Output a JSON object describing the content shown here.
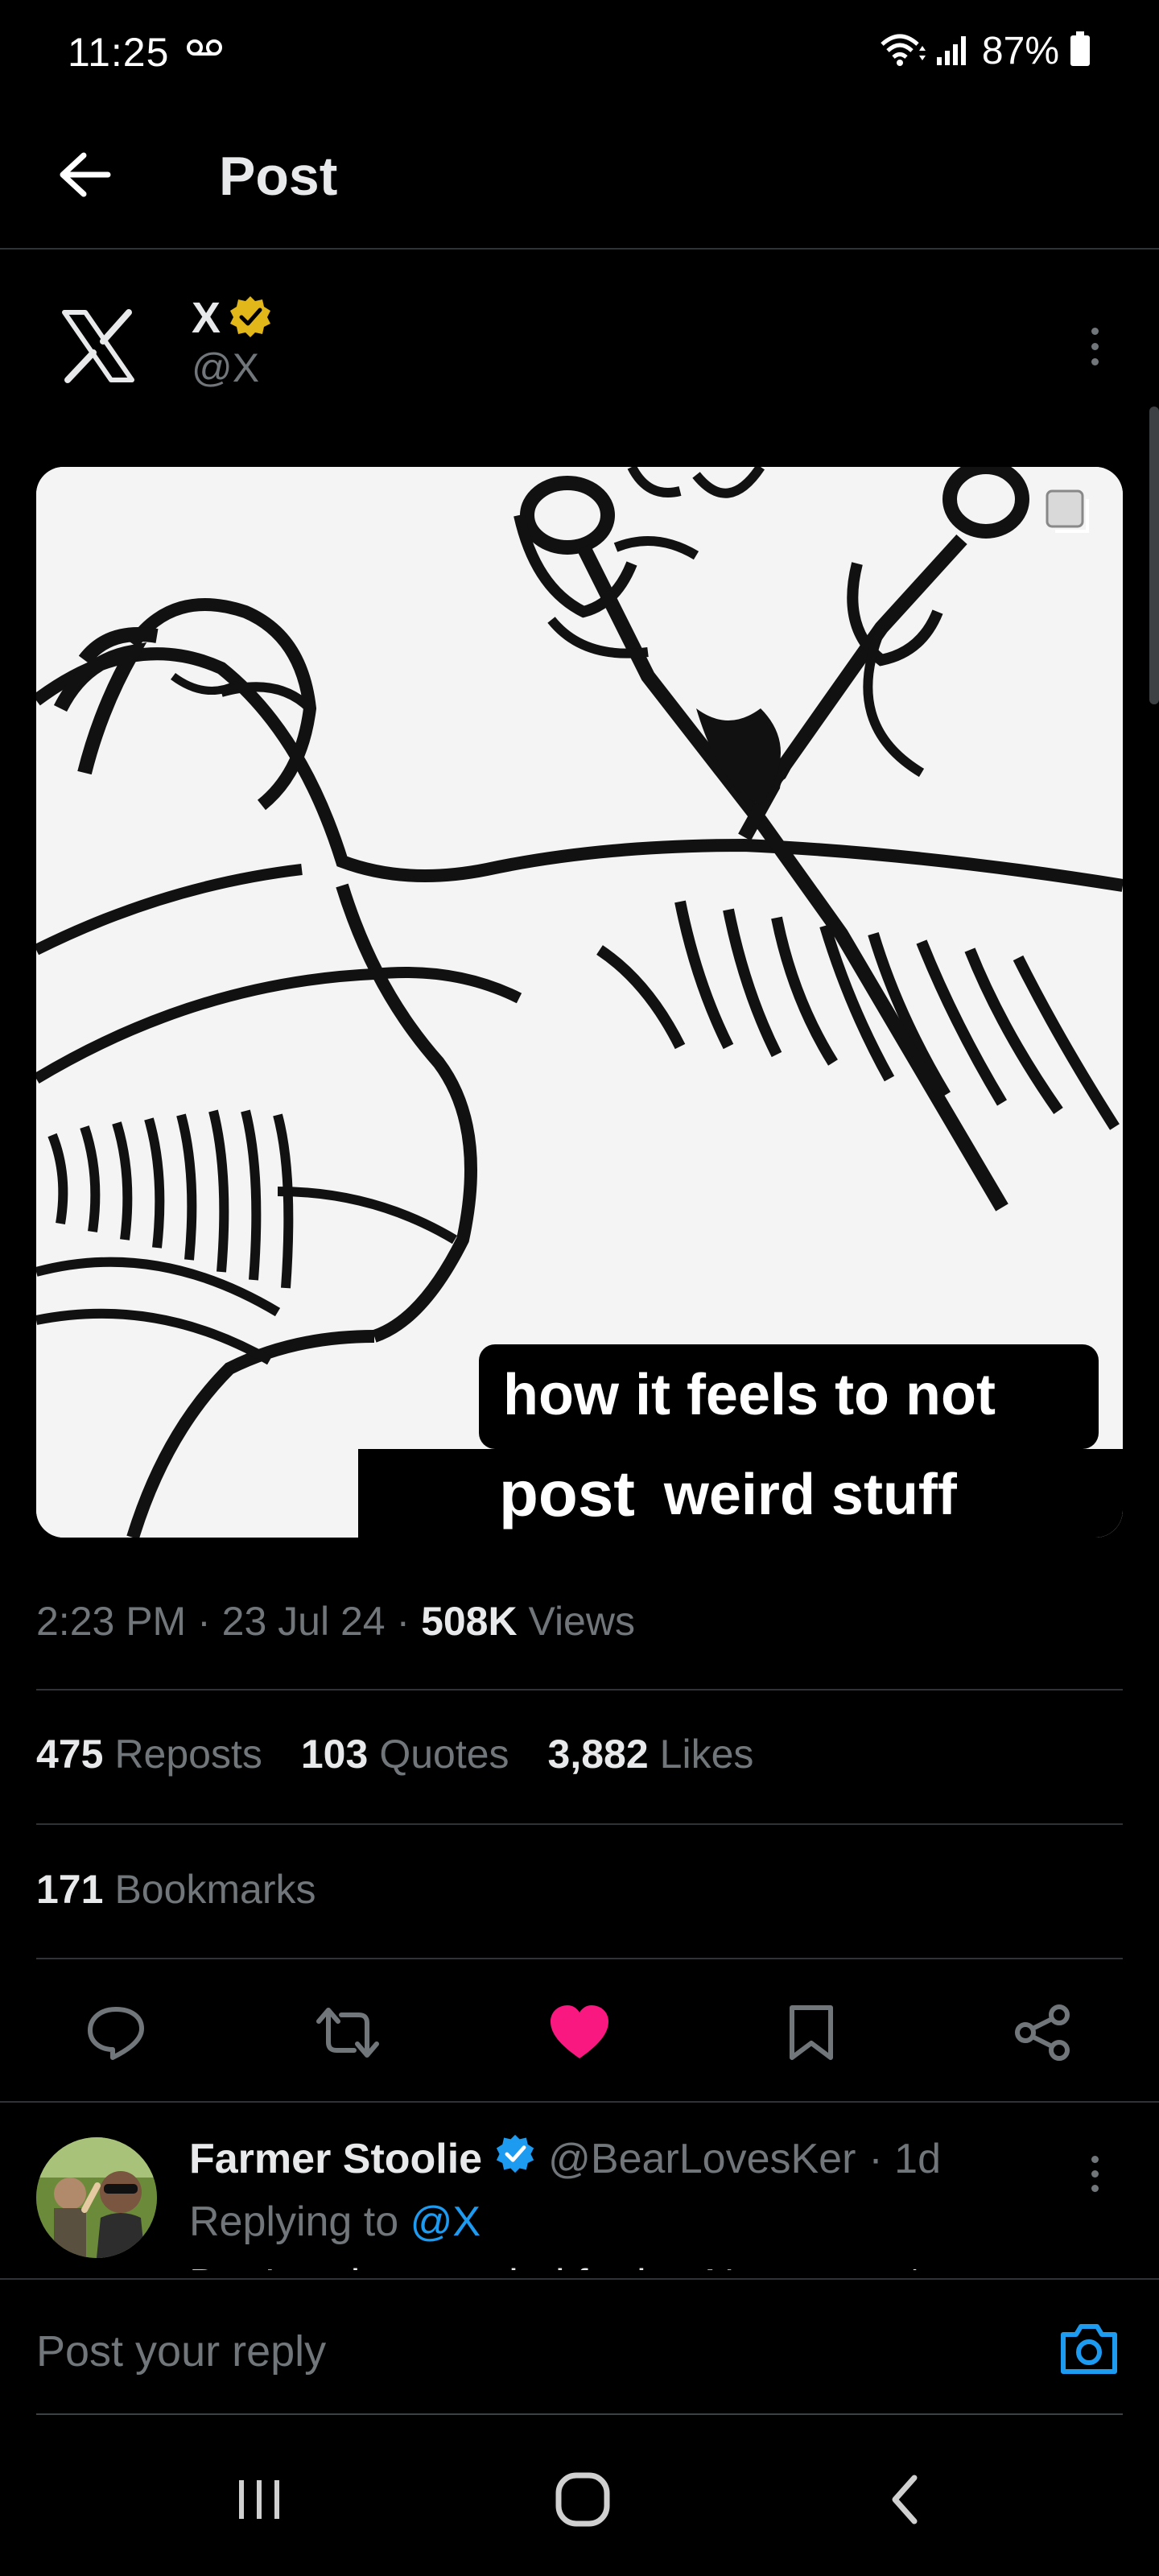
{
  "status": {
    "time": "11:25",
    "battery": "87%"
  },
  "header": {
    "title": "Post"
  },
  "author": {
    "name": "X",
    "handle": "@X",
    "verified_color": "#e2b719"
  },
  "media": {
    "caption_line1": "how it feels to not",
    "caption_line2_word1": "post",
    "caption_line2_word2": "weird stuff"
  },
  "meta": {
    "time": "2:23 PM",
    "date": "23 Jul 24",
    "views_count": "508K",
    "views_label": "Views"
  },
  "stats": {
    "reposts_count": "475",
    "reposts_label": "Reposts",
    "quotes_count": "103",
    "quotes_label": "Quotes",
    "likes_count": "3,882",
    "likes_label": "Likes",
    "bookmarks_count": "171",
    "bookmarks_label": "Bookmarks"
  },
  "actions": {
    "like_color": "#f91880"
  },
  "reply": {
    "name": "Farmer Stoolie",
    "handle": "@BearLovesKer",
    "age": "· 1d",
    "replying_prefix": "Replying to",
    "replying_mention": "@X",
    "preview": "Don't wait to go viral for it...   Not to post*"
  },
  "composer": {
    "placeholder": "Post your reply"
  },
  "colors": {
    "accent": "#1d9bf0",
    "background": "#000000",
    "muted": "#71767b"
  }
}
